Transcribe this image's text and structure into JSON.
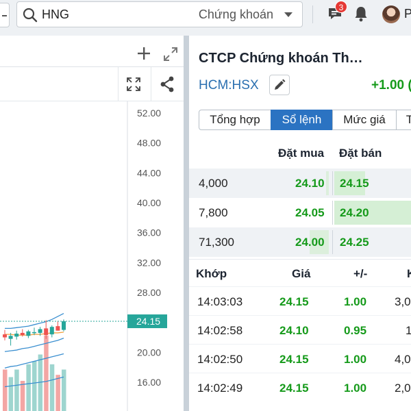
{
  "topbar": {
    "search_value": "HNG",
    "search_scope": "Chứng khoán",
    "notification_count": "3",
    "user_initial": "P"
  },
  "stock": {
    "company_name": "CTCP Chứng khoán Th…",
    "ticker": "HCM:HSX",
    "change": "+1.00 (",
    "change_color": "#159a1a"
  },
  "tabs": [
    {
      "label": "Tổng hợp",
      "active": false
    },
    {
      "label": "Sổ lệnh",
      "active": true
    },
    {
      "label": "Mức giá",
      "active": false
    },
    {
      "label": "T",
      "active": false
    }
  ],
  "order_book": {
    "headers": {
      "bid": "Đặt mua",
      "ask": "Đặt bán"
    },
    "rows": [
      {
        "volume": "4,000",
        "bid": "24.10",
        "ask": "24.15",
        "bid_fill": 0.04,
        "ask_fill": 0.4
      },
      {
        "volume": "7,800",
        "bid": "24.05",
        "ask": "24.20",
        "bid_fill": 0.0,
        "ask_fill": 1.0
      },
      {
        "volume": "71,300",
        "bid": "24.00",
        "ask": "24.25",
        "bid_fill": 0.28,
        "ask_fill": 0.0
      }
    ]
  },
  "trades": {
    "headers": {
      "time": "Khớp",
      "price": "Giá",
      "change": "+/-",
      "volume": "K"
    },
    "rows": [
      {
        "time": "14:03:03",
        "price": "24.15",
        "change": "1.00",
        "volume": "3,0"
      },
      {
        "time": "14:02:58",
        "price": "24.10",
        "change": "0.95",
        "volume": "1"
      },
      {
        "time": "14:02:50",
        "price": "24.15",
        "change": "1.00",
        "volume": "4,0"
      },
      {
        "time": "14:02:49",
        "price": "24.15",
        "change": "1.00",
        "volume": "2,0"
      }
    ]
  },
  "chart_data": {
    "type": "candlestick",
    "y_ticks": [
      "52.00",
      "48.00",
      "44.00",
      "40.00",
      "36.00",
      "32.00",
      "28.00",
      "20.00",
      "16.00"
    ],
    "ylim": [
      14,
      53
    ],
    "last_price": "24.15",
    "last_price_value": 24.15,
    "candles": [
      {
        "o": 22.4,
        "h": 23.0,
        "l": 21.6,
        "c": 22.0,
        "up": false
      },
      {
        "o": 21.8,
        "h": 22.6,
        "l": 20.9,
        "c": 22.2,
        "up": true
      },
      {
        "o": 22.1,
        "h": 22.9,
        "l": 21.7,
        "c": 22.5,
        "up": true
      },
      {
        "o": 22.6,
        "h": 23.1,
        "l": 22.1,
        "c": 22.3,
        "up": false
      },
      {
        "o": 22.2,
        "h": 23.0,
        "l": 21.9,
        "c": 22.8,
        "up": true
      },
      {
        "o": 22.7,
        "h": 23.3,
        "l": 22.3,
        "c": 22.6,
        "up": true
      },
      {
        "o": 22.6,
        "h": 23.4,
        "l": 22.2,
        "c": 23.1,
        "up": true
      },
      {
        "o": 23.2,
        "h": 24.3,
        "l": 21.8,
        "c": 22.3,
        "up": false
      },
      {
        "o": 22.4,
        "h": 23.6,
        "l": 22.0,
        "c": 23.4,
        "up": true
      },
      {
        "o": 23.5,
        "h": 24.2,
        "l": 22.9,
        "c": 22.9,
        "up": false
      },
      {
        "o": 23.0,
        "h": 24.4,
        "l": 22.8,
        "c": 24.15,
        "up": true
      }
    ],
    "volumes": [
      0.55,
      0.45,
      0.55,
      0.4,
      0.62,
      0.66,
      0.75,
      1.0,
      0.62,
      0.48,
      0.55
    ],
    "ma_lines": [
      {
        "color": "#3a8fd0",
        "values": [
          23.2,
          23.2,
          23.3,
          23.4,
          23.5,
          23.7,
          23.9,
          24.1,
          24.4,
          24.8,
          25.2
        ]
      },
      {
        "color": "#f2a03d",
        "values": [
          22.4,
          22.4,
          22.3,
          22.3,
          22.3,
          22.4,
          22.4,
          22.5,
          22.6,
          22.6,
          22.7
        ]
      },
      {
        "color": "#3a8fd0",
        "values": [
          20.1,
          20.2,
          20.3,
          20.5,
          20.6,
          20.8,
          21.0,
          21.2,
          21.4,
          21.6,
          21.9
        ]
      },
      {
        "color": "#3a8fd0",
        "values": [
          17.9,
          18.1,
          18.2,
          18.4,
          18.6,
          18.8,
          19.0,
          19.2,
          19.4,
          19.6,
          19.8
        ]
      },
      {
        "color": "#3a8fd0",
        "values": [
          15.4,
          15.5,
          15.6,
          15.7,
          15.8,
          15.9,
          16.0,
          16.1,
          16.3,
          16.5,
          16.7
        ]
      }
    ],
    "up_color": "#26a69a",
    "down_color": "#ef5350",
    "last_price_color": "#26a69a"
  }
}
